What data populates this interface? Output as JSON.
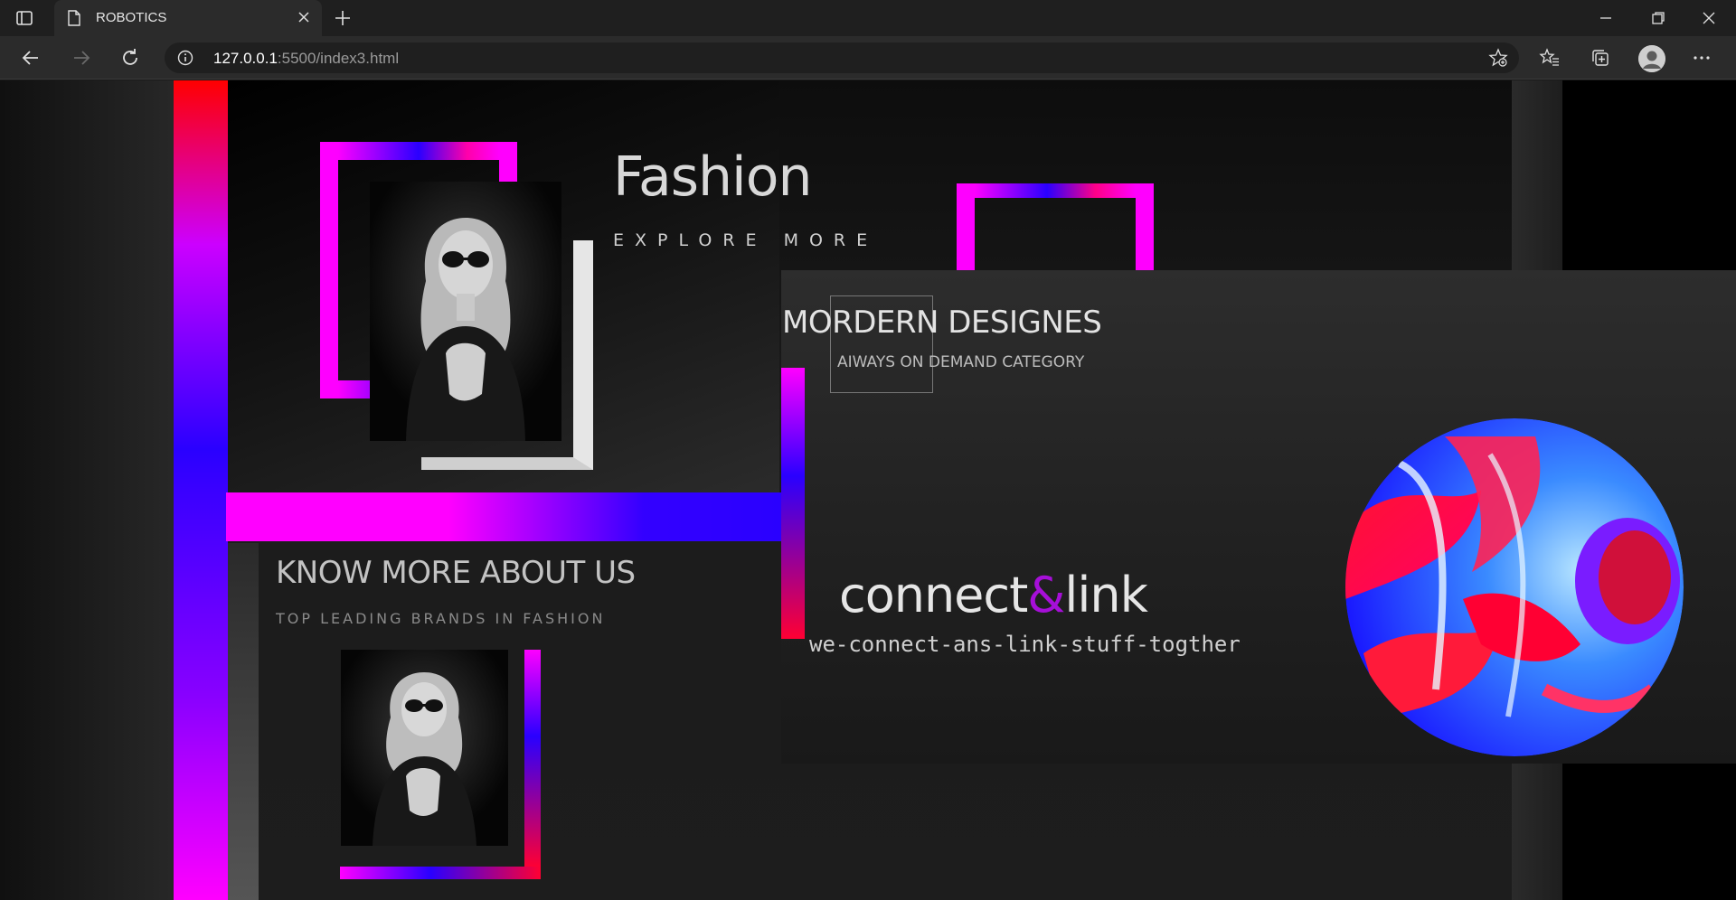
{
  "browser": {
    "tab_title": "ROBOTICS",
    "url_host": "127.0.0.1",
    "url_rest": ":5500/index3.html"
  },
  "hero": {
    "title": "Fashion",
    "subtitle": "EXPLORE MORE"
  },
  "card": {
    "heading": "MORDERN DESIGNES",
    "subheading": "AIWAYS ON DEMAND CATEGORY",
    "brand_word1": "connect",
    "brand_amp": "&",
    "brand_word2": "link",
    "tagline": "we-connect-ans-link-stuff-togther"
  },
  "about": {
    "heading": "KNOW MORE ABOUT US",
    "subheading": "TOP LEADING BRANDS IN FASHION"
  },
  "colors": {
    "accent_magenta": "#ff00ff",
    "accent_blue": "#2a00ff",
    "accent_red": "#ff0000",
    "amp_purple": "#a60fd8"
  },
  "icons": [
    "tab-actions-icon",
    "page-icon",
    "close-icon",
    "plus-icon",
    "minimize-icon",
    "restore-icon",
    "window-close-icon",
    "back-icon",
    "forward-icon",
    "refresh-icon",
    "info-icon",
    "add-favorite-icon",
    "favorites-icon",
    "collections-icon",
    "profile-icon",
    "more-icon"
  ]
}
